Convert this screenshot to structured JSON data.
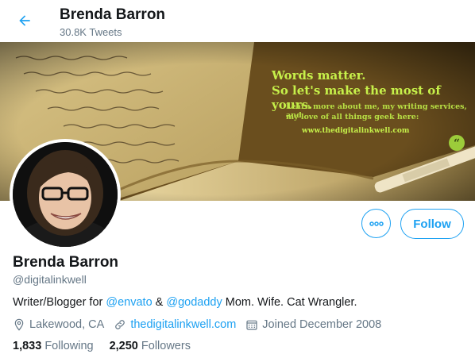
{
  "header": {
    "name": "Brenda Barron",
    "tweet_count": "30.8K Tweets"
  },
  "banner": {
    "line1": "Words matter.",
    "line2": "So let's make the most of yours.",
    "small1": "Learn more about me, my writing services, and",
    "small2": "my love of all things geek here:",
    "url": "www.thedigitalinkwell.com",
    "accent_color": "#c6f04a"
  },
  "profile": {
    "name": "Brenda Barron",
    "handle": "@digitalinkwell",
    "bio_prefix": "Writer/Blogger for ",
    "mention1": "@envato",
    "bio_mid": " & ",
    "mention2": "@godaddy",
    "bio_suffix": " Mom. Wife. Cat Wrangler.",
    "location": "Lakewood, CA",
    "website": "thedigitalinkwell.com",
    "joined": "Joined December 2008"
  },
  "actions": {
    "more_icon": "more-icon",
    "follow_label": "Follow"
  },
  "stats": {
    "following_count": "1,833",
    "following_label": "Following",
    "followers_count": "2,250",
    "followers_label": "Followers"
  },
  "colors": {
    "accent": "#1da1f2",
    "secondary_text": "#657786",
    "primary_text": "#14171a"
  }
}
